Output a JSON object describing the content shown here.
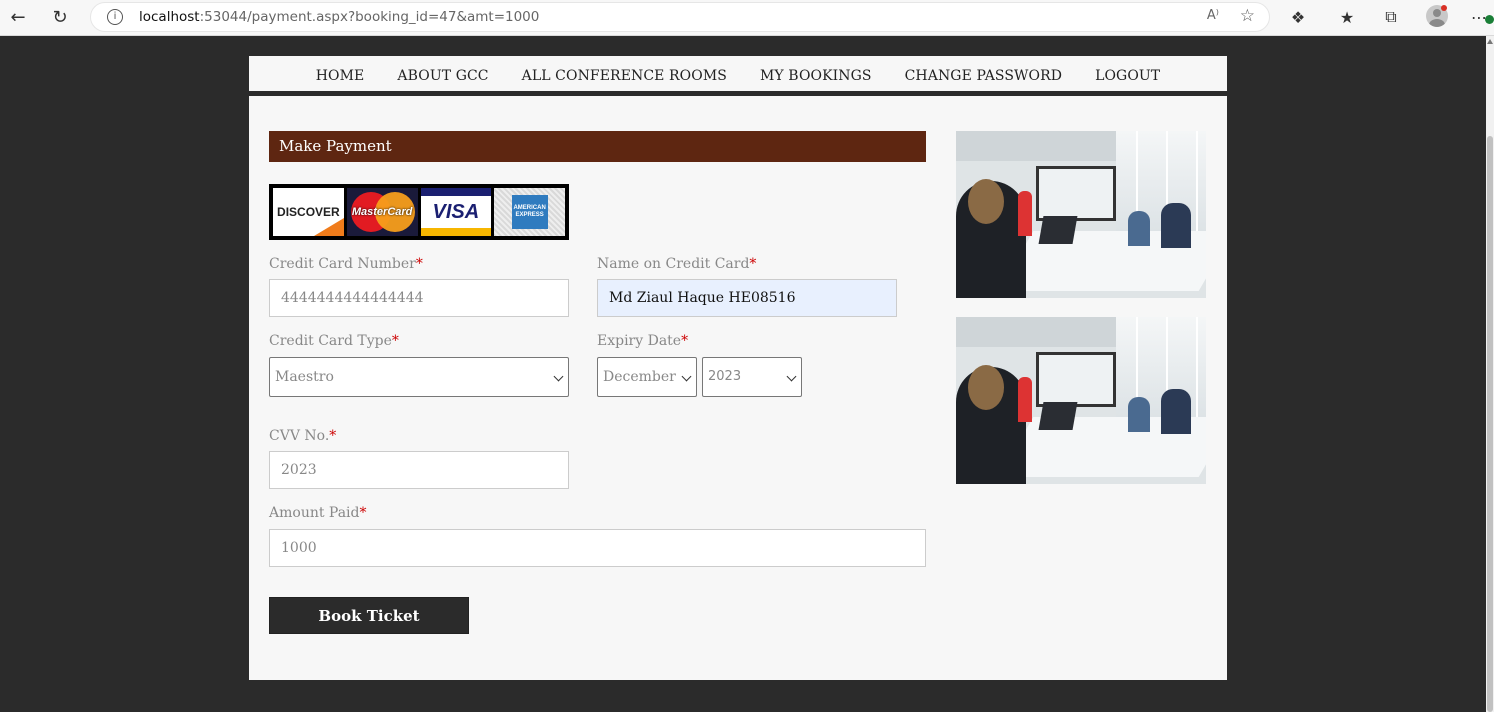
{
  "browser": {
    "url_host": "localhost",
    "url_rest": ":53044/payment.aspx?booking_id=47&amt=1000",
    "read_aloud": "A⁾"
  },
  "nav": {
    "items": [
      "HOME",
      "ABOUT GCC",
      "ALL CONFERENCE ROOMS",
      "MY BOOKINGS",
      "CHANGE PASSWORD",
      "LOGOUT"
    ]
  },
  "payment": {
    "title": "Make Payment",
    "cards": {
      "discover": "DISCOVER",
      "mastercard": "MasterCard",
      "visa": "VISA",
      "amex": "AMERICAN EXPRESS"
    },
    "card_number": {
      "label": "Credit Card Number",
      "value": "4444444444444444"
    },
    "name_on_card": {
      "label": "Name on Credit Card",
      "value": "Md Ziaul Haque HE08516"
    },
    "card_type": {
      "label": "Credit Card Type",
      "value": "Maestro"
    },
    "expiry": {
      "label": "Expiry Date",
      "month": "December",
      "year": "2023"
    },
    "cvv": {
      "label": "CVV No.",
      "value": "2023"
    },
    "amount": {
      "label": "Amount Paid",
      "value": "1000"
    },
    "required_mark": "*",
    "submit_label": "Book Ticket"
  },
  "colors": {
    "header_bar": "#5e2611",
    "page_bg": "#2b2b2b",
    "button": "#2b2b2b",
    "required": "#cc0000"
  }
}
